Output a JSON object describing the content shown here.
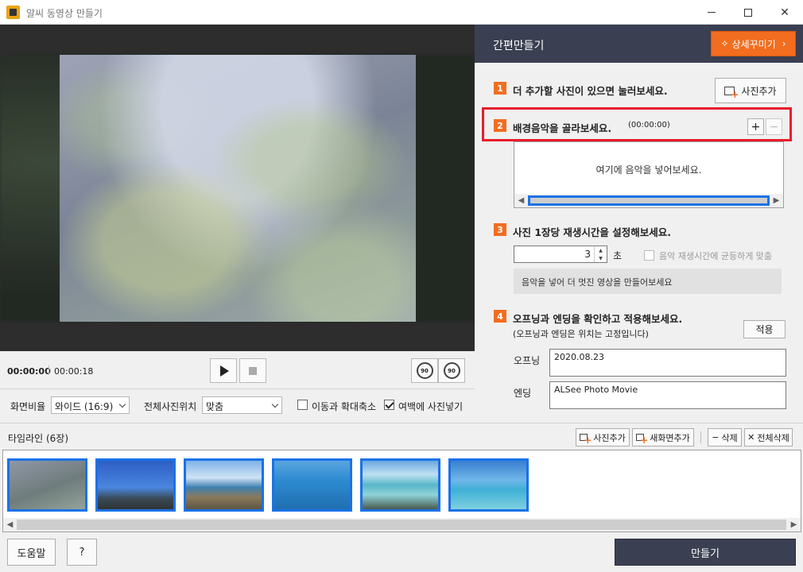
{
  "window": {
    "title": "알씨 동영상 만들기"
  },
  "preview": {
    "time_current": "00:00:00",
    "time_total": "00:00:18",
    "rotate_left_label": "90",
    "rotate_right_label": "90"
  },
  "options": {
    "aspect_label": "화면비율",
    "aspect_value": "와이드 (16:9)",
    "position_label": "전체사진위치",
    "position_value": "맞춤",
    "pan_zoom_label": "이동과 확대축소",
    "pan_zoom_checked": false,
    "fill_margin_label": "여백에 사진넣기",
    "fill_margin_checked": true
  },
  "panel": {
    "title": "간편만들기",
    "detail_button": "상세꾸미기",
    "step1": {
      "num": "1",
      "text": "더 추가할 사진이 있으면 눌러보세요.",
      "button": "사진추가"
    },
    "step2": {
      "num": "2",
      "text": "배경음악을 골라보세요.",
      "duration": "(00:00:00)",
      "add": "+",
      "remove": "−",
      "hint": "여기에 음악을 넣어보세요."
    },
    "step3": {
      "num": "3",
      "text": "사진 1장당 재생시간을 설정해보세요.",
      "value": "3",
      "unit": "초",
      "fit_label": "음악 재생시간에 균등하게 맞춤",
      "hint": "음악을 넣어 더 멋진 영상을 만들어보세요"
    },
    "step4": {
      "num": "4",
      "text": "오프닝과 엔딩을 확인하고 적용해보세요.",
      "subtext": "(오프닝과 엔딩은 위치는 고정입니다)",
      "apply": "적용",
      "opening_label": "오프닝",
      "opening_value": "2020.08.23",
      "ending_label": "엔딩",
      "ending_value": "ALSee Photo Movie"
    }
  },
  "timeline": {
    "title": "타임라인 (6장)",
    "add_photo": "사진추가",
    "add_screen": "새화면추가",
    "delete": "삭제",
    "delete_all": "전체삭제",
    "thumbnails": [
      {
        "name": "underwater-rocks"
      },
      {
        "name": "blue-sky-shore"
      },
      {
        "name": "boardwalk-coast"
      },
      {
        "name": "sea-rock"
      },
      {
        "name": "beach-island"
      },
      {
        "name": "turquoise-sea"
      }
    ]
  },
  "bottom": {
    "help": "도움말",
    "question": "?",
    "make": "만들기"
  }
}
